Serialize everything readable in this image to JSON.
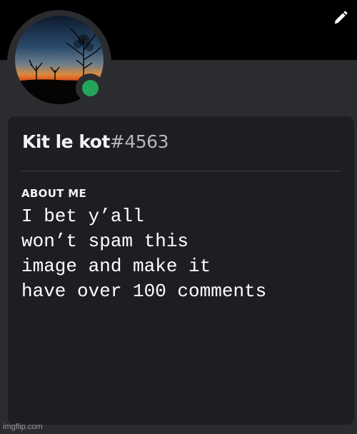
{
  "profile": {
    "username": "Kit le kot",
    "discriminator": "#4563",
    "status_color": "#23a55a",
    "edit_icon": "pencil-icon"
  },
  "about": {
    "heading": "ABOUT ME",
    "text": "I bet y’all\nwon’t spam this\nimage and make it\nhave over 100 comments"
  },
  "watermark": "imgflip.com"
}
